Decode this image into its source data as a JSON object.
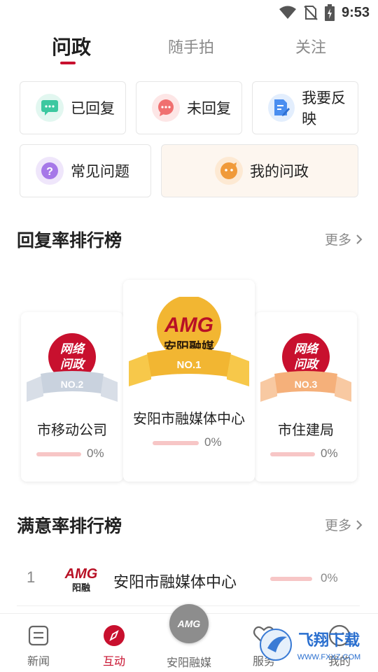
{
  "status_bar": {
    "time": "9:53"
  },
  "tabs": [
    {
      "label": "问政",
      "active": true
    },
    {
      "label": "随手拍",
      "active": false
    },
    {
      "label": "关注",
      "active": false
    }
  ],
  "quick_actions": [
    {
      "label": "已回复",
      "icon": "chat-bubble-icon",
      "color": "#3cc8a0"
    },
    {
      "label": "未回复",
      "icon": "chat-bubble-icon",
      "color": "#f07070"
    },
    {
      "label": "我要反映",
      "icon": "edit-document-icon",
      "color": "#4a8ef0"
    },
    {
      "label": "常见问题",
      "icon": "question-icon",
      "color": "#a678e8"
    },
    {
      "label": "我的问政",
      "icon": "face-icon",
      "color": "#f09a3a"
    }
  ],
  "reply_rank": {
    "title": "回复率排行榜",
    "more": "更多",
    "badge_text": [
      "网络",
      "问政"
    ],
    "items": [
      {
        "rank": "NO.1",
        "name": "安阳市融媒体中心",
        "percent": "0%",
        "logo_text": "AMG",
        "logo_sub": "安阳融媒"
      },
      {
        "rank": "NO.2",
        "name": "市移动公司",
        "percent": "0%"
      },
      {
        "rank": "NO.3",
        "name": "市住建局",
        "percent": "0%"
      }
    ]
  },
  "satisfaction_rank": {
    "title": "满意率排行榜",
    "more": "更多",
    "items": [
      {
        "rank": "1",
        "name": "安阳市融媒体中心",
        "percent": "0%",
        "logo_text": "AMG",
        "logo_sub": "阳融"
      }
    ]
  },
  "bottom_nav": [
    {
      "label": "新闻",
      "active": false
    },
    {
      "label": "互动",
      "active": true
    },
    {
      "label": "安阳融媒",
      "active": false,
      "center_text": "AMG"
    },
    {
      "label": "服务",
      "active": false
    },
    {
      "label": "我的",
      "active": false
    }
  ],
  "watermark": {
    "text": "飞翔下载",
    "url": "WWW.FXXZ.COM"
  },
  "colors": {
    "accent": "#c8102e",
    "gold": "#f2b632",
    "silver": "#c9d2de",
    "bronze": "#f5b07a"
  }
}
